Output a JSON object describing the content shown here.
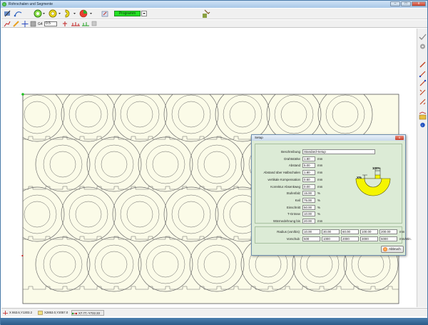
{
  "window": {
    "title": "Rohrschalen und Segmente"
  },
  "toolbar": {
    "program_label": "Programm"
  },
  "toolbar2": {
    "g4_label": "G4",
    "g4_value": "0.5"
  },
  "status": {
    "coord1": "X 863.6,Y1303.2",
    "coord2": "X2853.0,Y2057.0",
    "coord3": "X7.77,-Y722.33"
  },
  "dialog": {
    "title": "Setup",
    "close_label": "x",
    "rows": [
      {
        "label": "Beschreibung",
        "value": "Standard-Setup",
        "unit": ""
      },
      {
        "label": "Drahtstärke",
        "value": "1.80",
        "unit": "mm"
      },
      {
        "label": "Abstand",
        "value": "5.00",
        "unit": "mm"
      },
      {
        "label": "Abstand über Halbschalen",
        "value": "1.80",
        "unit": "mm"
      },
      {
        "label": "vertikale Kompensation",
        "value": "0.50",
        "unit": "mm"
      },
      {
        "label": "Korrektur Absenkweg",
        "value": "0.00",
        "unit": "mm"
      },
      {
        "label": "Stufenfalz",
        "value": "15.00",
        "unit": "%"
      },
      {
        "label": "Keil",
        "value": "75.00",
        "unit": "%"
      },
      {
        "label": "Einschnitt",
        "value": "50.00",
        "unit": "%"
      },
      {
        "label": "T-Grösse",
        "value": "10.00",
        "unit": "%"
      },
      {
        "label": "Wärmedehnung bis",
        "value": "20.00",
        "unit": "mm"
      }
    ],
    "diagram": {
      "top_label": "100%",
      "side_label": "X%",
      "fill_color": "#f5f500"
    },
    "radius": {
      "label": "Radius (von/bis)",
      "values": [
        "10.00",
        "30.00",
        "60.00",
        "100.00",
        "200.00"
      ],
      "unit": "mm"
    },
    "feed": {
      "label": "Vorschub",
      "values": [
        "500",
        "1000",
        "2000",
        "3000",
        "5000"
      ],
      "unit": "mm/Min."
    },
    "cancel_label": "Abbruch"
  }
}
